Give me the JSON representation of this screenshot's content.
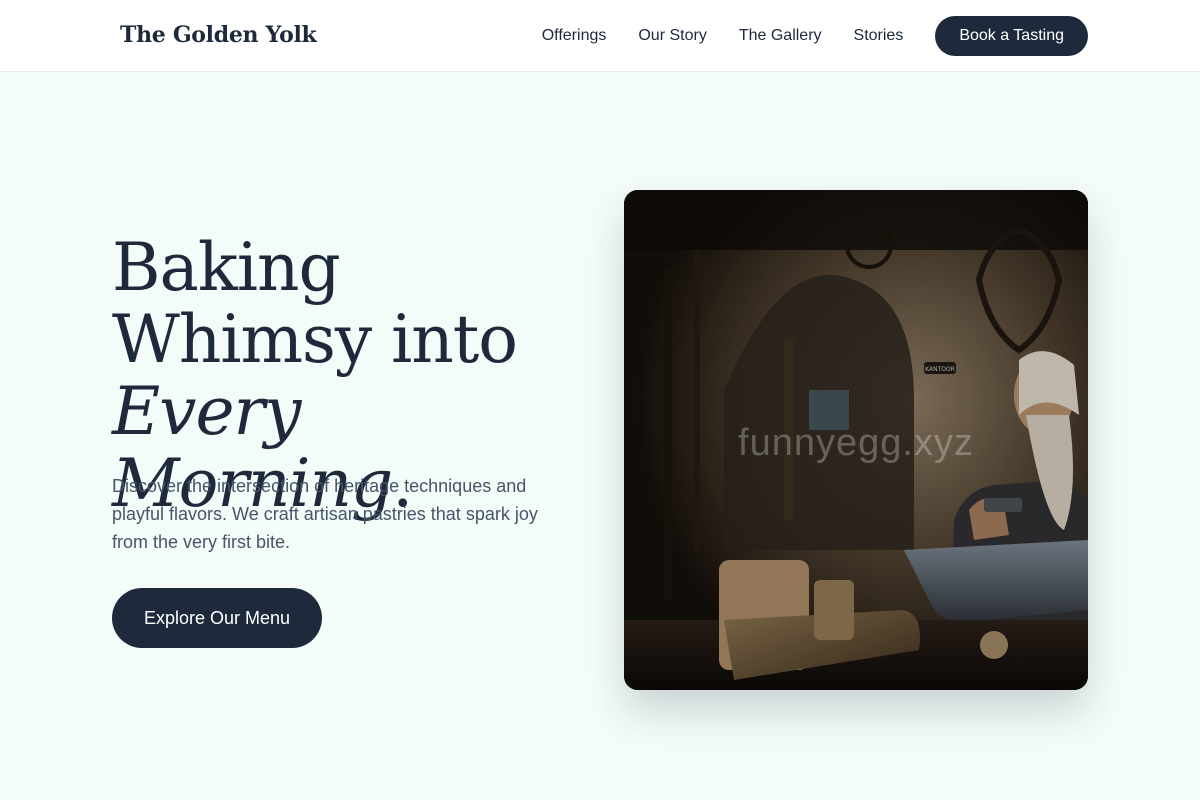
{
  "header": {
    "logo": "The Golden Yolk",
    "nav": [
      "Offerings",
      "Our Story",
      "The Gallery",
      "Stories"
    ],
    "cta": "Book a Tasting"
  },
  "hero": {
    "title_line1": "Baking",
    "title_line2": "Whimsy into",
    "title_line3_italic": "Every Morning",
    "title_punct": ".",
    "description": "Discover the intersection of heritage techniques and playful flavors. We craft artisan pastries that spark joy from the very first bite.",
    "cta": "Explore Our Menu",
    "image": {
      "subject": "blacksmith-workshop-photo",
      "watermark": "funnyegg.xyz",
      "sign_text": "KANTOOR"
    }
  },
  "colors": {
    "background": "#f3fcf8",
    "navy": "#1e293b",
    "text_muted": "#475569",
    "header_bg": "#ffffff"
  }
}
